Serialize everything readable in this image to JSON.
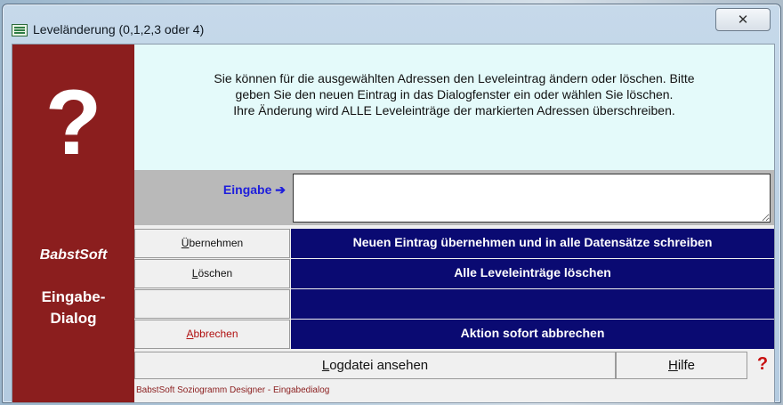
{
  "window": {
    "title": "Leveländerung (0,1,2,3 oder 4)",
    "close_glyph": "✕"
  },
  "sidebar": {
    "symbol": "?",
    "brand": "BabstSoft",
    "dialog_label_1": "Eingabe-",
    "dialog_label_2": "Dialog"
  },
  "info": {
    "line1": "Sie können für die ausgewählten Adressen den Leveleintrag ändern oder löschen. Bitte",
    "line2": "geben Sie den neuen Eintrag in das Dialogfenster ein oder wählen Sie löschen.",
    "line3": "Ihre Änderung wird ALLE Leveleinträge der markierten Adressen überschreiben."
  },
  "input": {
    "label": "Eingabe ➔",
    "value": "",
    "placeholder": ""
  },
  "actions": [
    {
      "label_ul": "Ü",
      "label_rest": "bernehmen",
      "description": "Neuen Eintrag übernehmen und in alle Datensätze schreiben"
    },
    {
      "label_ul": "L",
      "label_rest": "öschen",
      "description": "Alle Leveleinträge löschen"
    },
    {
      "label_ul": "",
      "label_rest": "",
      "description": ""
    },
    {
      "label_ul": "A",
      "label_rest": "bbrechen",
      "description": "Aktion sofort abbrechen"
    }
  ],
  "footer": {
    "log_ul": "L",
    "log_rest": "ogdatei ansehen",
    "help_ul": "H",
    "help_rest": "ilfe",
    "help_symbol": "?",
    "status": "BabstSoft Soziogramm Designer - Eingabedialog"
  },
  "colors": {
    "sidebar_bg": "#8b1e1e",
    "info_bg": "#e4fafa",
    "desc_bg": "#0a0a72",
    "input_label": "#1e1edc",
    "cancel_text": "#b01010"
  }
}
